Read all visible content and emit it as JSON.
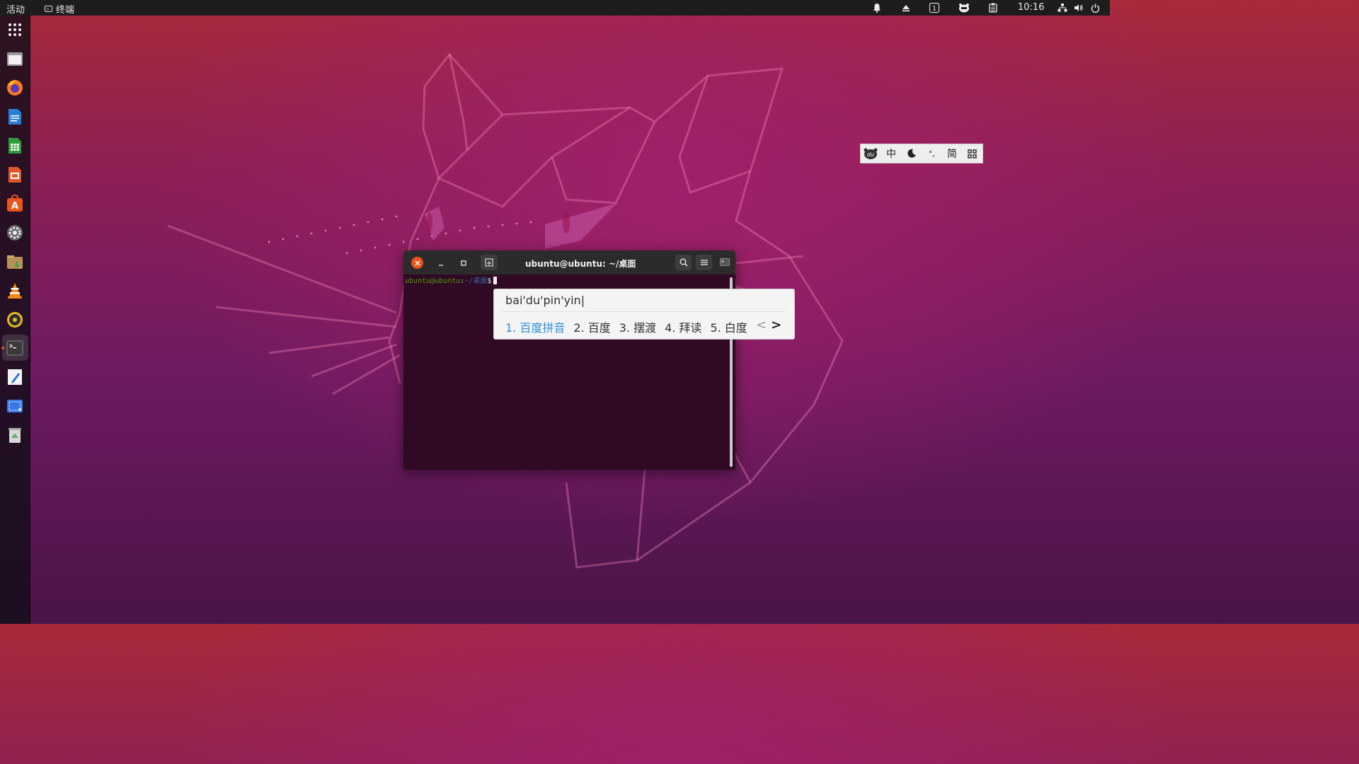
{
  "topbar": {
    "activities": "活动",
    "app_menu": "终端",
    "clock": "10:16"
  },
  "dock": {
    "items": [
      "apps-grid",
      "files",
      "firefox",
      "writer",
      "calc",
      "impress",
      "software",
      "settings",
      "archive",
      "vlc",
      "rhythmbox",
      "terminal",
      "text-editor",
      "screenshot",
      "trash"
    ]
  },
  "ime_bar": {
    "logo": "du",
    "mode": "中",
    "punct": "°,",
    "charset": "简"
  },
  "terminal": {
    "title": "ubuntu@ubuntu: ~/桌面",
    "prompt_user": "ubuntu@ubuntu",
    "prompt_sep": ":",
    "prompt_path": "~/桌面",
    "prompt_symbol": "$"
  },
  "candidate": {
    "preedit": "bai'du'pin'yin|",
    "items": [
      "1. 百度拼音",
      "2. 百度",
      "3. 摆渡",
      "4. 拜读",
      "5. 白度"
    ],
    "prev": "<",
    "next": ">"
  },
  "colors": {
    "accent": "#e95420",
    "terminal_bg": "#300a24",
    "candidate_selected": "#2e8fd8"
  }
}
